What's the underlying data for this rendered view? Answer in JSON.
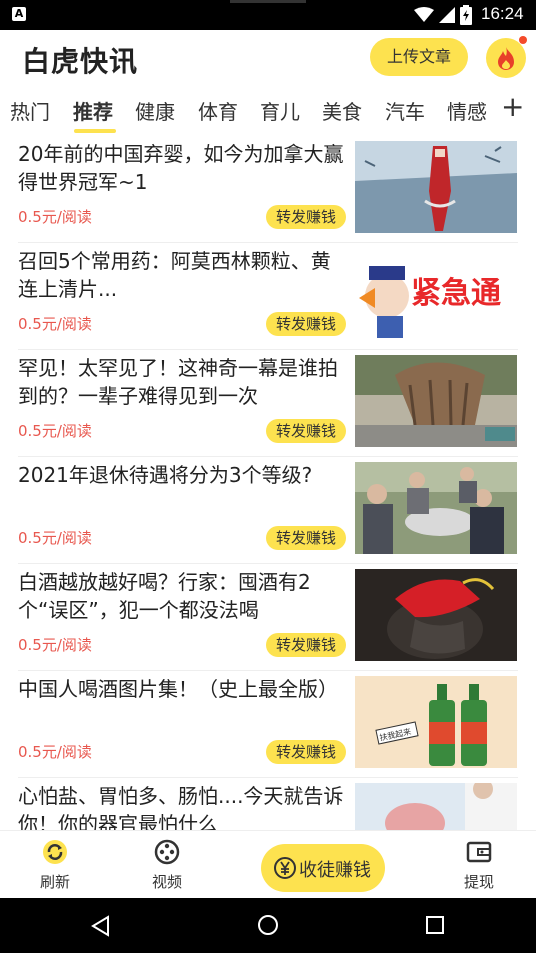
{
  "status_bar": {
    "time": "16:24"
  },
  "header": {
    "app_title": "白虎快讯",
    "upload_label": "上传文章"
  },
  "tabs": [
    {
      "label": "热门"
    },
    {
      "label": "推荐"
    },
    {
      "label": "健康"
    },
    {
      "label": "体育"
    },
    {
      "label": "育儿"
    },
    {
      "label": "美食"
    },
    {
      "label": "汽车"
    },
    {
      "label": "情感"
    }
  ],
  "tab_add_label": "+",
  "share_label": "转发赚钱",
  "feed": [
    {
      "title": "20年前的中国弃婴，如今为加拿大赢得世界冠军~1",
      "price": "0.5元/阅读"
    },
    {
      "title": "召回5个常用药：阿莫西林颗粒、黄连上清片...",
      "price": "0.5元/阅读"
    },
    {
      "title": "罕见！太罕见了！这神奇一幕是谁拍到的？一辈子难得见到一次",
      "price": "0.5元/阅读"
    },
    {
      "title": "2021年退休待遇将分为3个等级?",
      "price": "0.5元/阅读"
    },
    {
      "title": "白酒越放越好喝？行家：囤酒有2个“误区”，犯一个都没法喝",
      "price": "0.5元/阅读"
    },
    {
      "title": "中国人喝酒图片集！（史上最全版）",
      "price": "0.5元/阅读"
    },
    {
      "title": "心怕盐、胃怕多、肠怕....今天就告诉你！你的器官最怕什么",
      "price": ""
    }
  ],
  "thumb_text": {
    "urgent": "紧急通",
    "sign": "扶我起来"
  },
  "bottom_nav": {
    "refresh_label": "刷新",
    "video_label": "视频",
    "collect_label": "收徒赚钱",
    "withdraw_label": "提现"
  },
  "colors": {
    "accent": "#fde24f",
    "price": "#e8584f"
  }
}
